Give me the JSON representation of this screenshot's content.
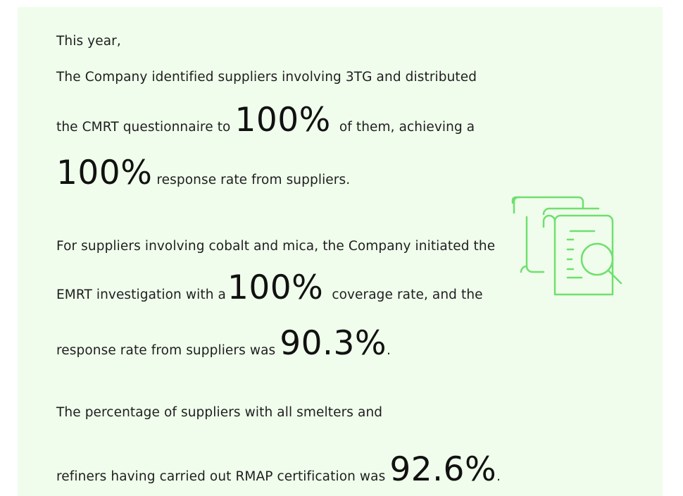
{
  "intro": "This year,",
  "para1": {
    "line1": "The Company identified suppliers involving 3TG and distributed",
    "line2_pre": "the CMRT questionnaire to",
    "line2_stat": "100%",
    "line2_post": "of them, achieving a",
    "line3_stat": "100%",
    "line3_post": "response rate from suppliers."
  },
  "para2": {
    "line1": "For suppliers involving cobalt and mica, the Company initiated the",
    "line2_pre": "EMRT investigation with a",
    "line2_stat": "100%",
    "line2_post": "coverage rate, and the",
    "line3_pre": "response rate from suppliers was",
    "line3_stat": "90.3%",
    "line3_post": "."
  },
  "para3": {
    "line1": "The percentage of suppliers with all smelters and",
    "line2_pre": "refiners having carried out RMAP certification was",
    "line2_stat": "92.6%",
    "line2_post": "."
  },
  "colors": {
    "background": "#f0fdec",
    "icon_stroke": "#6fe06f",
    "text": "#1e1e1e"
  },
  "icons": {
    "document_search": "document-search-icon"
  }
}
